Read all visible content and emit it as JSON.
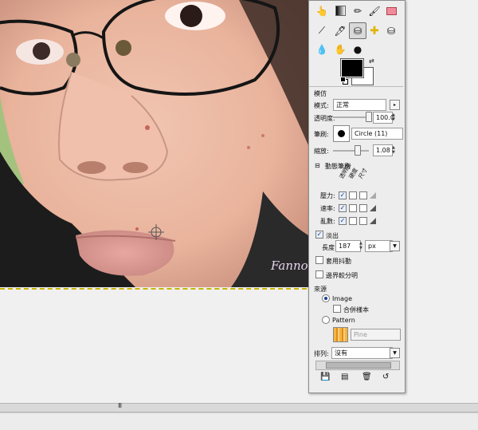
{
  "canvas": {
    "watermark_text": "Fanno",
    "photo_description_icon": "photo-icon"
  },
  "statusbar": {
    "grip_label": "III"
  },
  "toolbox": {
    "tools": [
      {
        "icon": "clone-hand-icon"
      },
      {
        "icon": "gradient-icon"
      },
      {
        "icon": "pencil-icon"
      },
      {
        "icon": "eraser-icon"
      },
      {
        "icon": "color-picker-icon"
      },
      {
        "icon": "ink-icon"
      },
      {
        "icon": "clone-stamp-icon"
      },
      {
        "icon": "heal-icon"
      },
      {
        "icon": "smudge-icon"
      },
      {
        "icon": "blur-icon"
      },
      {
        "icon": "dodge-icon"
      },
      {
        "icon": "airbrush-icon"
      }
    ],
    "colors": {
      "fg": "#000000",
      "bg": "#ffffff"
    }
  },
  "options": {
    "title": "模仿",
    "mode_label": "模式:",
    "mode_value": "正常",
    "opacity_label": "透明度:",
    "opacity_value": "100.0",
    "brush_label": "筆刷:",
    "brush_value": "Circle (11)",
    "scale_label": "縮放:",
    "scale_value": "1.08",
    "dynamics_label": "動態筆刷",
    "col_headers": [
      "透明度",
      "硬度",
      "尺寸"
    ],
    "row_pressure": "壓力:",
    "row_velocity": "速率:",
    "row_random": "亂數:",
    "fade_label": "淡出",
    "length_label": "長度:",
    "length_value": "187",
    "length_unit": "px",
    "hard_edge_label": "套用抖動",
    "incremental_label": "邊界較分明",
    "source_label": "來源",
    "image_label": "Image",
    "sample_merged_label": "合併樣本",
    "pattern_label": "Pattern",
    "pattern_name": "Pine",
    "align_label": "排列:",
    "align_value": "沒有"
  }
}
